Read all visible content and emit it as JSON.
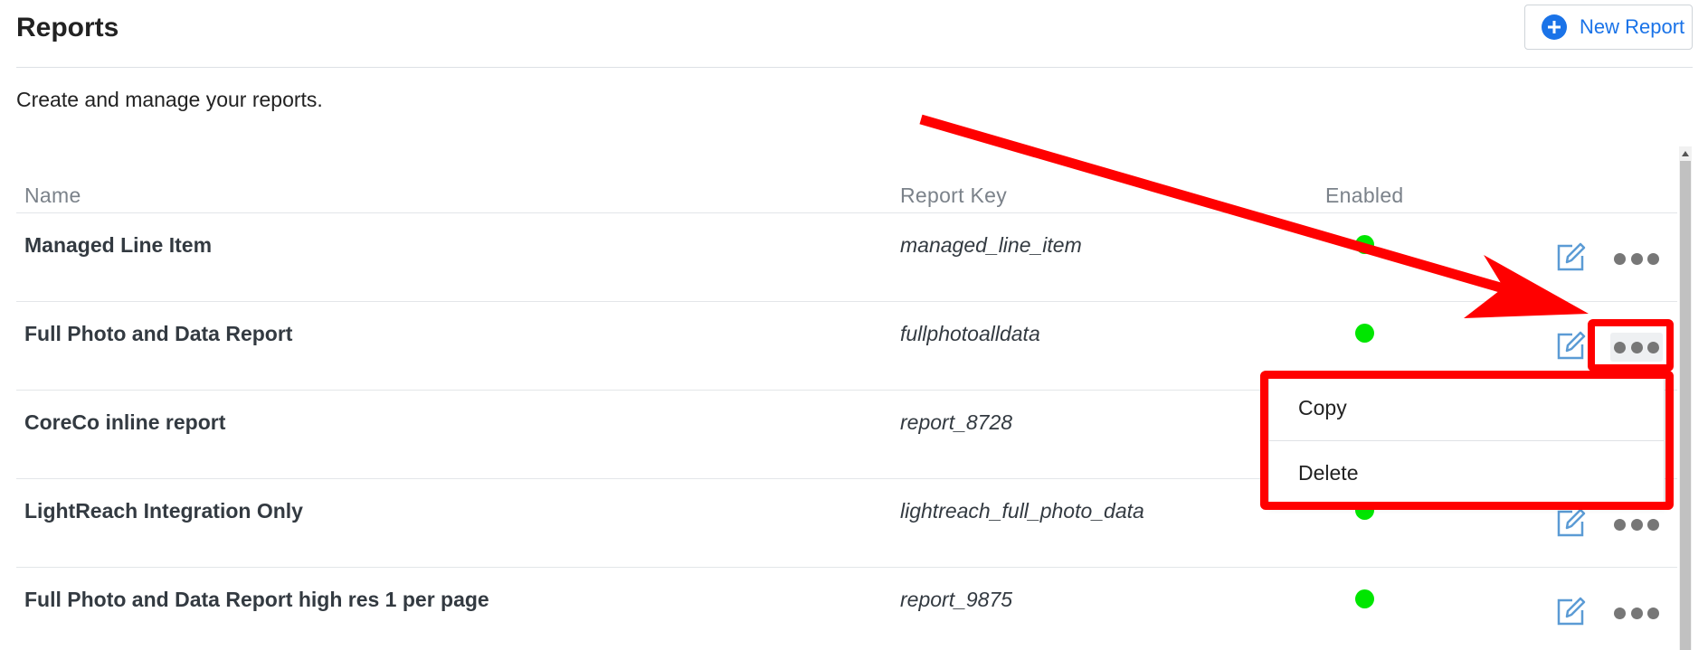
{
  "header": {
    "title": "Reports",
    "new_report_label": "New Report"
  },
  "subtitle": "Create and manage your reports.",
  "table": {
    "columns": {
      "name": "Name",
      "report_key": "Report Key",
      "enabled": "Enabled"
    },
    "rows": [
      {
        "name": "Managed Line Item",
        "key": "managed_line_item",
        "enabled": true
      },
      {
        "name": "Full Photo and Data Report",
        "key": "fullphotoalldata",
        "enabled": true
      },
      {
        "name": "CoreCo inline report",
        "key": "report_8728",
        "enabled": true
      },
      {
        "name": "LightReach Integration Only",
        "key": "lightreach_full_photo_data",
        "enabled": true
      },
      {
        "name": "Full Photo and Data Report high res 1 per page",
        "key": "report_9875",
        "enabled": true
      }
    ]
  },
  "dropdown": {
    "items": [
      "Copy",
      "Delete"
    ]
  },
  "icons": {
    "new_report": "plus-circle-icon",
    "edit": "edit-icon",
    "more": "more-horizontal-icon"
  },
  "colors": {
    "accent": "#1a73e8",
    "enabled_dot": "#00e600",
    "annotation": "#ff0000"
  }
}
